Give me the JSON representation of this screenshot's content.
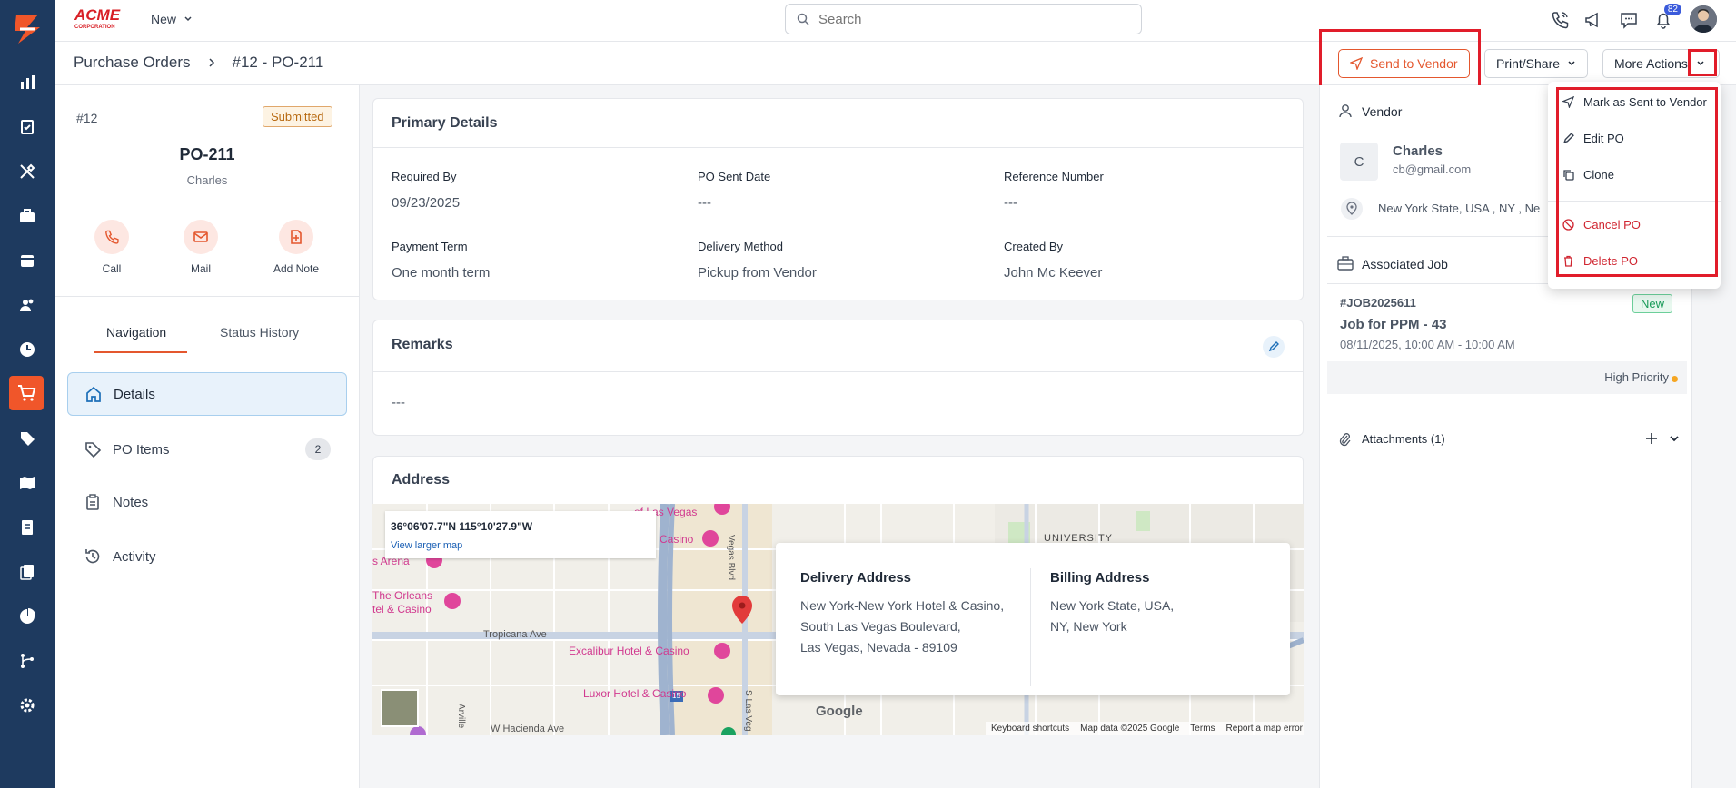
{
  "topbar": {
    "brand": "ACME CORPORATION",
    "new_label": "New",
    "search_placeholder": "Search",
    "notification_count": "82"
  },
  "breadcrumb": {
    "parent": "Purchase Orders",
    "current": "#12 - PO-211"
  },
  "header_actions": {
    "send_to_vendor": "Send to Vendor",
    "print_share": "Print/Share",
    "more_actions": "More Actions"
  },
  "more_actions_menu": [
    {
      "label": "Mark as Sent to Vendor",
      "icon": "send-icon"
    },
    {
      "label": "Edit PO",
      "icon": "pencil-icon"
    },
    {
      "label": "Clone",
      "icon": "copy-icon"
    },
    {
      "label": "Cancel PO",
      "icon": "ban-icon"
    },
    {
      "label": "Delete PO",
      "icon": "trash-icon"
    }
  ],
  "po_summary": {
    "number": "#12",
    "status": "Submitted",
    "title": "PO-211",
    "vendor_name": "Charles",
    "actions": [
      {
        "label": "Call",
        "icon": "phone-icon"
      },
      {
        "label": "Mail",
        "icon": "mail-icon"
      },
      {
        "label": "Add Note",
        "icon": "note-add-icon"
      }
    ]
  },
  "tabs": [
    "Navigation",
    "Status History"
  ],
  "nav": [
    {
      "label": "Details",
      "icon": "home-icon"
    },
    {
      "label": "PO Items",
      "icon": "tag-icon",
      "count": "2"
    },
    {
      "label": "Notes",
      "icon": "clipboard-icon"
    },
    {
      "label": "Activity",
      "icon": "history-icon"
    }
  ],
  "primary_details": {
    "title": "Primary Details",
    "fields": [
      {
        "label": "Required By",
        "value": "09/23/2025"
      },
      {
        "label": "PO Sent Date",
        "value": "---"
      },
      {
        "label": "Reference Number",
        "value": "---"
      },
      {
        "label": "Payment Term",
        "value": "One month term"
      },
      {
        "label": "Delivery Method",
        "value": "Pickup from Vendor"
      },
      {
        "label": "Created By",
        "value": "John Mc Keever"
      }
    ]
  },
  "remarks": {
    "title": "Remarks",
    "value": "---"
  },
  "address": {
    "title": "Address",
    "coords": "36°06'07.7\"N 115°10'27.9\"W",
    "view_larger_map": "View larger map",
    "delivery_title": "Delivery Address",
    "delivery_lines": [
      "New York-New York Hotel & Casino,",
      "South Las Vegas Boulevard,",
      "Las Vegas, Nevada - 89109"
    ],
    "billing_title": "Billing Address",
    "billing_lines": [
      "New York State, USA,",
      "NY, New York"
    ],
    "map_labels": {
      "las_vegas": "of Las Vegas",
      "casino": "Casino",
      "arena": "s Arena",
      "orleans_1": "The Orleans",
      "orleans_2": "tel & Casino",
      "tropicana": "Tropicana Ave",
      "excalibur": "Excalibur Hotel & Casino",
      "luxor": "Luxor Hotel & Casino",
      "hacienda": "W Hacienda Ave",
      "university": "UNIVERSITY",
      "lv_blvd": "Vegas Blvd",
      "s_las_veg": "S Las Veg",
      "arville": "Arville",
      "route": "15",
      "google": "Google",
      "keyboard": "Keyboard shortcuts",
      "map_data": "Map data ©2025 Google",
      "terms": "Terms",
      "report": "Report a map error"
    }
  },
  "vendor": {
    "section_title": "Vendor",
    "initial": "C",
    "name": "Charles",
    "email": "cb@gmail.com",
    "address": "New York State, USA , NY , Ne"
  },
  "associated_job": {
    "section_title": "Associated Job",
    "job_id": "#JOB2025611",
    "status": "New",
    "title": "Job for PPM - 43",
    "schedule": "08/11/2025, 10:00 AM - 10:00 AM",
    "priority": "High Priority"
  },
  "attachments": {
    "label": "Attachments (1)"
  },
  "colors": {
    "accent": "#e4572e",
    "rail": "#1e3a5f",
    "highlight": "#e11d2a"
  }
}
